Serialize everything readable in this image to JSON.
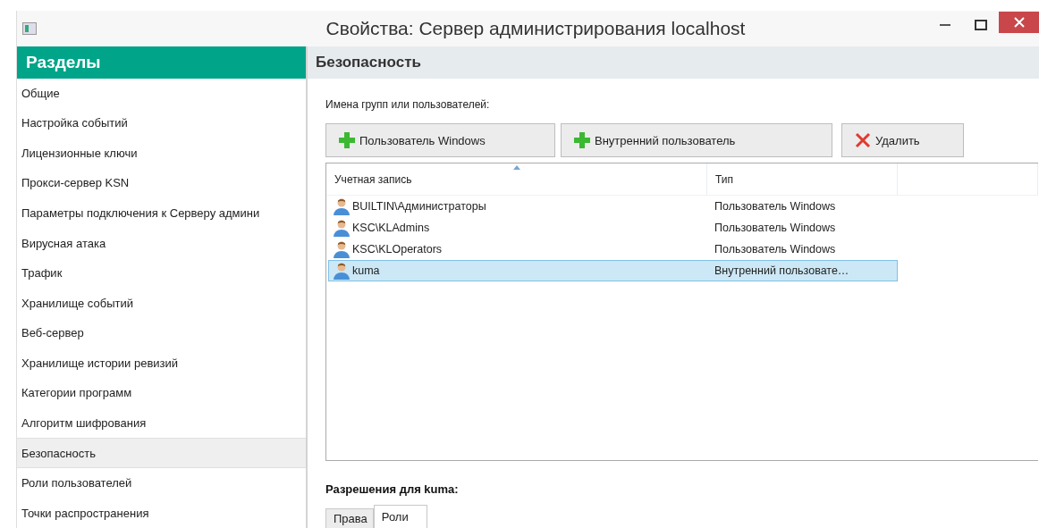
{
  "window": {
    "title": "Свойства: Сервер администрирования localhost"
  },
  "sidebar": {
    "title": "Разделы",
    "items": [
      {
        "label": "Общие",
        "selected": false
      },
      {
        "label": "Настройка событий",
        "selected": false
      },
      {
        "label": "Лицензионные ключи",
        "selected": false
      },
      {
        "label": "Прокси-сервер KSN",
        "selected": false
      },
      {
        "label": "Параметры подключения к Серверу админи",
        "selected": false
      },
      {
        "label": "Вирусная атака",
        "selected": false
      },
      {
        "label": "Трафик",
        "selected": false
      },
      {
        "label": "Хранилище событий",
        "selected": false
      },
      {
        "label": "Веб-сервер",
        "selected": false
      },
      {
        "label": "Хранилище истории ревизий",
        "selected": false
      },
      {
        "label": "Категории программ",
        "selected": false
      },
      {
        "label": "Алгоритм шифрования",
        "selected": false
      },
      {
        "label": "Безопасность",
        "selected": true
      },
      {
        "label": "Роли пользователей",
        "selected": false
      },
      {
        "label": "Точки распространения",
        "selected": false
      }
    ]
  },
  "section": {
    "title": "Безопасность",
    "groups_label": "Имена групп или пользователей:",
    "buttons": [
      {
        "kind": "add",
        "label": "Пользователь Windows"
      },
      {
        "kind": "add",
        "label": "Внутренний пользователь"
      },
      {
        "kind": "delete",
        "label": "Удалить"
      }
    ],
    "table": {
      "columns": [
        "Учетная запись",
        "Тип"
      ],
      "rows": [
        {
          "account": "BUILTIN\\Администраторы",
          "type": "Пользователь Windows",
          "selected": false
        },
        {
          "account": "KSC\\KLAdmins",
          "type": "Пользователь Windows",
          "selected": false
        },
        {
          "account": "KSC\\KLOperators",
          "type": "Пользователь Windows",
          "selected": false
        },
        {
          "account": "kuma",
          "type": "Внутренний пользовате…",
          "selected": true
        }
      ]
    },
    "permissions_label": "Разрешения для kuma:",
    "tabs": [
      {
        "label": "Права",
        "selected": false
      },
      {
        "label": "Роли",
        "selected": true
      }
    ]
  }
}
